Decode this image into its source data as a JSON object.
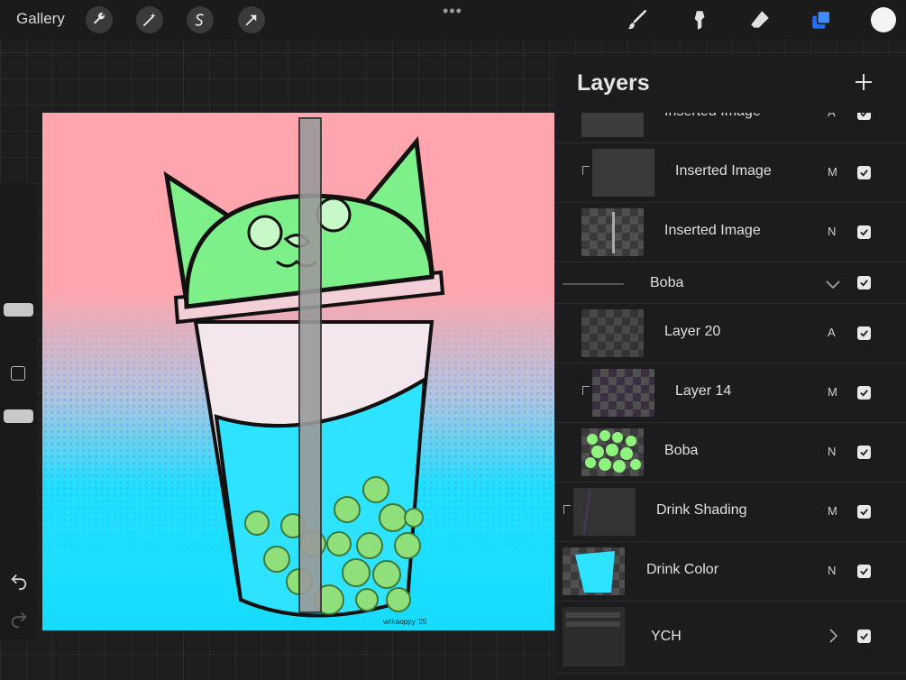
{
  "toolbar": {
    "gallery_label": "Gallery",
    "more_dots": "•••",
    "icons": [
      "wrench-icon",
      "magic-wand-icon",
      "selection-icon",
      "transform-arrow-icon",
      "brush-icon",
      "smudge-icon",
      "eraser-icon",
      "layers-icon",
      "color-icon"
    ],
    "active_tool_color": "#1e6fff",
    "current_color": "#f4f4f4"
  },
  "canvas": {
    "signature": "witkaoppy '25",
    "colors": {
      "top": "#ffa5ad",
      "bottom": "#16dcfb",
      "lid": "#7ef08a",
      "drink": "#2ee3ff",
      "boba": "#8fe07a"
    }
  },
  "layers_panel": {
    "title": "Layers",
    "layers": [
      {
        "name": "Inserted Image",
        "blend": "A",
        "visible": true,
        "clipped": false,
        "kind": "image"
      },
      {
        "name": "Inserted Image",
        "blend": "M",
        "visible": true,
        "clipped": true,
        "kind": "image"
      },
      {
        "name": "Inserted Image",
        "blend": "N",
        "visible": true,
        "clipped": false,
        "kind": "image"
      },
      {
        "name": "Boba",
        "blend": "",
        "visible": true,
        "clipped": false,
        "kind": "group-open"
      },
      {
        "name": "Layer 20",
        "blend": "A",
        "visible": true,
        "clipped": false,
        "kind": "image"
      },
      {
        "name": "Layer 14",
        "blend": "M",
        "visible": true,
        "clipped": true,
        "kind": "image"
      },
      {
        "name": "Boba",
        "blend": "N",
        "visible": true,
        "clipped": false,
        "kind": "image"
      },
      {
        "name": "Drink Shading",
        "blend": "M",
        "visible": true,
        "clipped": true,
        "kind": "image"
      },
      {
        "name": "Drink Color",
        "blend": "N",
        "visible": true,
        "clipped": false,
        "kind": "image"
      },
      {
        "name": "YCH",
        "blend": "",
        "visible": true,
        "clipped": false,
        "kind": "group-closed"
      }
    ]
  }
}
